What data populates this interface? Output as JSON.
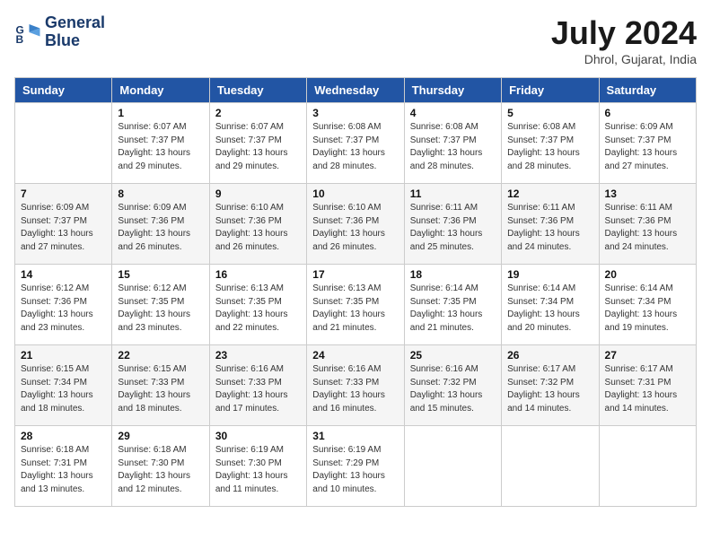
{
  "header": {
    "logo_line1": "General",
    "logo_line2": "Blue",
    "month": "July 2024",
    "location": "Dhrol, Gujarat, India"
  },
  "weekdays": [
    "Sunday",
    "Monday",
    "Tuesday",
    "Wednesday",
    "Thursday",
    "Friday",
    "Saturday"
  ],
  "weeks": [
    [
      {
        "day": "",
        "info": ""
      },
      {
        "day": "1",
        "info": "Sunrise: 6:07 AM\nSunset: 7:37 PM\nDaylight: 13 hours\nand 29 minutes."
      },
      {
        "day": "2",
        "info": "Sunrise: 6:07 AM\nSunset: 7:37 PM\nDaylight: 13 hours\nand 29 minutes."
      },
      {
        "day": "3",
        "info": "Sunrise: 6:08 AM\nSunset: 7:37 PM\nDaylight: 13 hours\nand 28 minutes."
      },
      {
        "day": "4",
        "info": "Sunrise: 6:08 AM\nSunset: 7:37 PM\nDaylight: 13 hours\nand 28 minutes."
      },
      {
        "day": "5",
        "info": "Sunrise: 6:08 AM\nSunset: 7:37 PM\nDaylight: 13 hours\nand 28 minutes."
      },
      {
        "day": "6",
        "info": "Sunrise: 6:09 AM\nSunset: 7:37 PM\nDaylight: 13 hours\nand 27 minutes."
      }
    ],
    [
      {
        "day": "7",
        "info": "Sunrise: 6:09 AM\nSunset: 7:37 PM\nDaylight: 13 hours\nand 27 minutes."
      },
      {
        "day": "8",
        "info": "Sunrise: 6:09 AM\nSunset: 7:36 PM\nDaylight: 13 hours\nand 26 minutes."
      },
      {
        "day": "9",
        "info": "Sunrise: 6:10 AM\nSunset: 7:36 PM\nDaylight: 13 hours\nand 26 minutes."
      },
      {
        "day": "10",
        "info": "Sunrise: 6:10 AM\nSunset: 7:36 PM\nDaylight: 13 hours\nand 26 minutes."
      },
      {
        "day": "11",
        "info": "Sunrise: 6:11 AM\nSunset: 7:36 PM\nDaylight: 13 hours\nand 25 minutes."
      },
      {
        "day": "12",
        "info": "Sunrise: 6:11 AM\nSunset: 7:36 PM\nDaylight: 13 hours\nand 24 minutes."
      },
      {
        "day": "13",
        "info": "Sunrise: 6:11 AM\nSunset: 7:36 PM\nDaylight: 13 hours\nand 24 minutes."
      }
    ],
    [
      {
        "day": "14",
        "info": "Sunrise: 6:12 AM\nSunset: 7:36 PM\nDaylight: 13 hours\nand 23 minutes."
      },
      {
        "day": "15",
        "info": "Sunrise: 6:12 AM\nSunset: 7:35 PM\nDaylight: 13 hours\nand 23 minutes."
      },
      {
        "day": "16",
        "info": "Sunrise: 6:13 AM\nSunset: 7:35 PM\nDaylight: 13 hours\nand 22 minutes."
      },
      {
        "day": "17",
        "info": "Sunrise: 6:13 AM\nSunset: 7:35 PM\nDaylight: 13 hours\nand 21 minutes."
      },
      {
        "day": "18",
        "info": "Sunrise: 6:14 AM\nSunset: 7:35 PM\nDaylight: 13 hours\nand 21 minutes."
      },
      {
        "day": "19",
        "info": "Sunrise: 6:14 AM\nSunset: 7:34 PM\nDaylight: 13 hours\nand 20 minutes."
      },
      {
        "day": "20",
        "info": "Sunrise: 6:14 AM\nSunset: 7:34 PM\nDaylight: 13 hours\nand 19 minutes."
      }
    ],
    [
      {
        "day": "21",
        "info": "Sunrise: 6:15 AM\nSunset: 7:34 PM\nDaylight: 13 hours\nand 18 minutes."
      },
      {
        "day": "22",
        "info": "Sunrise: 6:15 AM\nSunset: 7:33 PM\nDaylight: 13 hours\nand 18 minutes."
      },
      {
        "day": "23",
        "info": "Sunrise: 6:16 AM\nSunset: 7:33 PM\nDaylight: 13 hours\nand 17 minutes."
      },
      {
        "day": "24",
        "info": "Sunrise: 6:16 AM\nSunset: 7:33 PM\nDaylight: 13 hours\nand 16 minutes."
      },
      {
        "day": "25",
        "info": "Sunrise: 6:16 AM\nSunset: 7:32 PM\nDaylight: 13 hours\nand 15 minutes."
      },
      {
        "day": "26",
        "info": "Sunrise: 6:17 AM\nSunset: 7:32 PM\nDaylight: 13 hours\nand 14 minutes."
      },
      {
        "day": "27",
        "info": "Sunrise: 6:17 AM\nSunset: 7:31 PM\nDaylight: 13 hours\nand 14 minutes."
      }
    ],
    [
      {
        "day": "28",
        "info": "Sunrise: 6:18 AM\nSunset: 7:31 PM\nDaylight: 13 hours\nand 13 minutes."
      },
      {
        "day": "29",
        "info": "Sunrise: 6:18 AM\nSunset: 7:30 PM\nDaylight: 13 hours\nand 12 minutes."
      },
      {
        "day": "30",
        "info": "Sunrise: 6:19 AM\nSunset: 7:30 PM\nDaylight: 13 hours\nand 11 minutes."
      },
      {
        "day": "31",
        "info": "Sunrise: 6:19 AM\nSunset: 7:29 PM\nDaylight: 13 hours\nand 10 minutes."
      },
      {
        "day": "",
        "info": ""
      },
      {
        "day": "",
        "info": ""
      },
      {
        "day": "",
        "info": ""
      }
    ]
  ]
}
